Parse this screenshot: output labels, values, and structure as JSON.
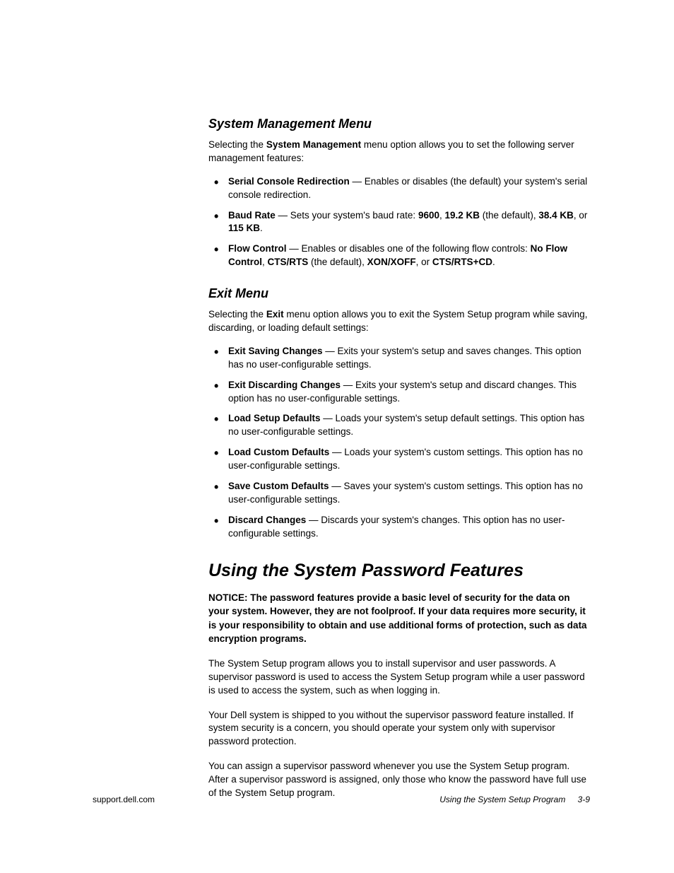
{
  "sections": [
    {
      "heading": "System Management Menu",
      "intro_pre": "Selecting the ",
      "intro_bold": "System Management",
      "intro_post": " menu option allows you to set the following server management features:",
      "items": [
        {
          "runs": [
            {
              "text": "Serial Console Redirection",
              "bold": true
            },
            {
              "text": " — Enables or disables (the default) your system's serial console redirection."
            }
          ]
        },
        {
          "runs": [
            {
              "text": "Baud Rate",
              "bold": true
            },
            {
              "text": " — Sets your system's baud rate: "
            },
            {
              "text": "9600",
              "bold": true
            },
            {
              "text": ", "
            },
            {
              "text": "19.2 KB",
              "bold": true
            },
            {
              "text": " (the default), "
            },
            {
              "text": "38.4 KB",
              "bold": true
            },
            {
              "text": ", or "
            },
            {
              "text": "115 KB",
              "bold": true
            },
            {
              "text": "."
            }
          ]
        },
        {
          "runs": [
            {
              "text": "Flow Control",
              "bold": true
            },
            {
              "text": " — Enables or disables one of the following flow controls: "
            },
            {
              "text": "No Flow Control",
              "bold": true
            },
            {
              "text": ", "
            },
            {
              "text": "CTS/RTS",
              "bold": true
            },
            {
              "text": " (the default), "
            },
            {
              "text": "XON/XOFF",
              "bold": true
            },
            {
              "text": ", or "
            },
            {
              "text": "CTS/RTS+CD",
              "bold": true
            },
            {
              "text": "."
            }
          ]
        }
      ]
    },
    {
      "heading": "Exit Menu",
      "intro_pre": "Selecting the ",
      "intro_bold": "Exit",
      "intro_post": " menu option allows you to exit the System Setup program while saving, discarding, or loading default settings:",
      "items": [
        {
          "runs": [
            {
              "text": "Exit Saving Changes",
              "bold": true
            },
            {
              "text": " — Exits your system's setup and saves changes. This option has no user-configurable settings."
            }
          ]
        },
        {
          "runs": [
            {
              "text": "Exit Discarding Changes",
              "bold": true
            },
            {
              "text": " — Exits your system's setup and discard changes. This option has no user-configurable settings."
            }
          ]
        },
        {
          "runs": [
            {
              "text": "Load Setup Defaults",
              "bold": true
            },
            {
              "text": " — Loads your system's setup default settings. This option has no user-configurable settings."
            }
          ]
        },
        {
          "runs": [
            {
              "text": "Load Custom Defaults",
              "bold": true
            },
            {
              "text": " — Loads your system's custom settings. This option has no user-configurable settings."
            }
          ]
        },
        {
          "runs": [
            {
              "text": "Save Custom Defaults",
              "bold": true
            },
            {
              "text": " — Saves your system's custom settings. This option has no user-configurable settings."
            }
          ]
        },
        {
          "runs": [
            {
              "text": "Discard Changes",
              "bold": true
            },
            {
              "text": " — Discards your system's changes. This option has no user-configurable settings."
            }
          ]
        }
      ]
    }
  ],
  "main": {
    "heading": "Using the System Password Features",
    "notice": "NOTICE: The password features provide a basic level of security for the data on your system. However, they are not foolproof. If your data requires more security, it is your responsibility to obtain and use additional forms of protection, such as data encryption programs.",
    "paragraphs": [
      "The System Setup program allows you to install supervisor and user passwords. A supervisor password is used to access the System Setup program while a user password is used to access the system, such as when logging in.",
      "Your Dell system is shipped to you without the supervisor password feature installed. If system security is a concern, you should operate your system only with supervisor password protection.",
      "You can assign a supervisor password whenever you use the System Setup program. After a supervisor password is assigned, only those who know the password have full use of the System Setup program."
    ]
  },
  "footer": {
    "left": "support.dell.com",
    "right_title": "Using the System Setup Program",
    "page_number": "3-9"
  }
}
